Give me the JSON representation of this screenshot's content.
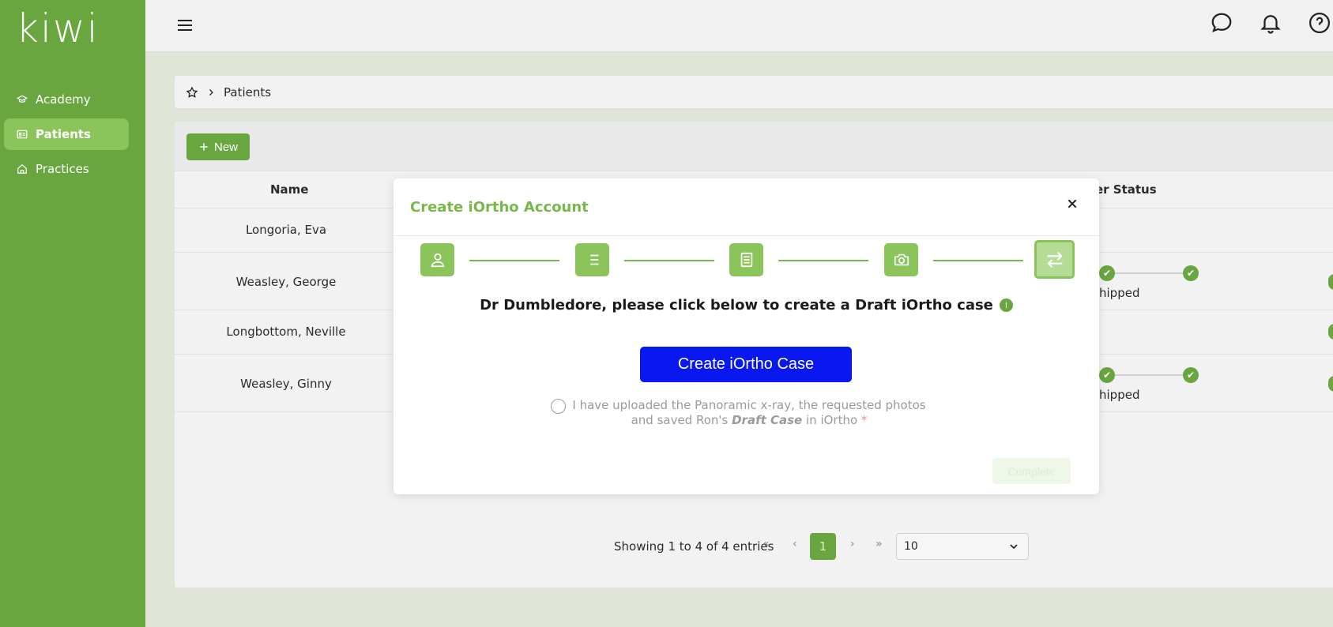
{
  "app": {
    "logo_text": "kiwi"
  },
  "sidebar": {
    "items": [
      {
        "label": "Academy",
        "icon": "graduation-cap-icon",
        "active": false
      },
      {
        "label": "Patients",
        "icon": "id-card-icon",
        "active": true
      },
      {
        "label": "Practices",
        "icon": "home-icon",
        "active": false
      }
    ]
  },
  "topbar": {
    "icons": [
      "chat-icon",
      "bell-icon",
      "help-icon"
    ]
  },
  "breadcrumb": {
    "current": "Patients"
  },
  "toolbar": {
    "new_label": "New"
  },
  "table": {
    "headers": {
      "name": "Name",
      "status": "er Status"
    },
    "rows": [
      {
        "name": "Longoria, Eva",
        "status_text": ""
      },
      {
        "name": "Weasley, George",
        "status_text": "hipped"
      },
      {
        "name": "Longbottom, Neville",
        "status_text": ""
      },
      {
        "name": "Weasley, Ginny",
        "status_text": "hipped"
      }
    ]
  },
  "pagination": {
    "info": "Showing 1 to 4 of 4 entries",
    "current_page": "1",
    "page_size": "10"
  },
  "modal": {
    "title": "Create iOrtho Account",
    "steps": [
      "person-icon",
      "list-icon",
      "document-icon",
      "camera-icon",
      "transfer-icon"
    ],
    "current_step": 5,
    "prompt": "Dr Dumbledore, please click below to create a Draft iOrtho case",
    "info_badge": "i",
    "create_button": "Create iOrtho Case",
    "confirm_line1": "I have uploaded the Panoramic x-ray, the requested photos",
    "confirm_line2_pre": "and saved Ron's ",
    "confirm_line2_em": "Draft Case",
    "confirm_line2_post": " in iOrtho ",
    "required_mark": "*",
    "complete_button": "Complete"
  },
  "colors": {
    "brand_green": "#6aa63f",
    "light_green": "#8cc45c",
    "create_blue": "#0a18f0"
  }
}
